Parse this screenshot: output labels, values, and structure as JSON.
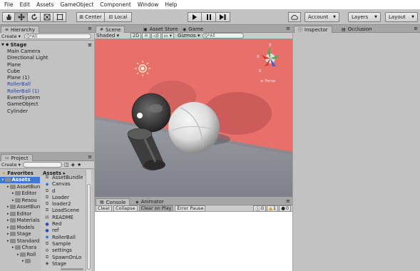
{
  "menu": [
    "File",
    "Edit",
    "Assets",
    "GameObject",
    "Component",
    "Window",
    "Help"
  ],
  "toolbar": {
    "tools": [
      "hand-icon",
      "move-icon",
      "rotate-icon",
      "scale-icon",
      "rect-icon"
    ],
    "center_label": "Center",
    "local_label": "Local",
    "play": "▶",
    "pause": "❚❚",
    "step": "▶❚",
    "account_label": "Account",
    "layers_label": "Layers",
    "layout_label": "Layout"
  },
  "hierarchy": {
    "tab": "Hierarchy",
    "create": "Create",
    "search_placeholder": "Q*All",
    "root": "Stage",
    "items": [
      {
        "label": "Main Camera",
        "prefab": false
      },
      {
        "label": "Directional Light",
        "prefab": false
      },
      {
        "label": "Plane",
        "prefab": false
      },
      {
        "label": "Cube",
        "prefab": false
      },
      {
        "label": "Plane (1)",
        "prefab": false
      },
      {
        "label": "RollerBall",
        "prefab": true
      },
      {
        "label": "RollerBall (1)",
        "prefab": true
      },
      {
        "label": "EventSystem",
        "prefab": false
      },
      {
        "label": "GameObject",
        "prefab": false
      },
      {
        "label": "Cylinder",
        "prefab": false
      }
    ]
  },
  "scene": {
    "tabs": [
      "Scene",
      "Asset Store",
      "Game"
    ],
    "shading": "Shaded",
    "mode_2d": "2D",
    "gizmos": "Gizmos",
    "search_placeholder": "Q*All",
    "persp_label": "≡ Persp",
    "axis_x": "x",
    "axis_y": "y",
    "axis_z": "z"
  },
  "inspector": {
    "tabs": [
      "Inspector",
      "Occlusion"
    ]
  },
  "console": {
    "tabs": [
      "Console",
      "Animator"
    ],
    "buttons": [
      "Clear",
      "Collapse",
      "Clear on Play",
      "Error Pause"
    ],
    "info_count": "0",
    "warn_count": "1",
    "error_count": "0"
  },
  "project": {
    "tab": "Project",
    "create": "Create",
    "favorites": "Favorites",
    "assets_header": "Assets",
    "breadcrumb": "Assets ▸",
    "tree": [
      {
        "label": "Assets",
        "level": 0
      },
      {
        "label": "AssetBun",
        "level": 1
      },
      {
        "label": "Editor",
        "level": 2
      },
      {
        "label": "Resou",
        "level": 2
      },
      {
        "label": "AssetBun",
        "level": 1
      },
      {
        "label": "Editor",
        "level": 1
      },
      {
        "label": "Materials",
        "level": 1
      },
      {
        "label": "Models",
        "level": 1
      },
      {
        "label": "Stage",
        "level": 1
      },
      {
        "label": "Standard",
        "level": 1
      },
      {
        "label": "Chara",
        "level": 2
      },
      {
        "label": "Roll",
        "level": 3
      },
      {
        "label": "",
        "level": 4
      }
    ],
    "assets": [
      {
        "label": "AssetBundle",
        "icon": "script-icon"
      },
      {
        "label": "Canvas",
        "icon": "prefab-icon"
      },
      {
        "label": "d",
        "icon": "script-icon"
      },
      {
        "label": "Loader",
        "icon": "script-icon"
      },
      {
        "label": "loader2",
        "icon": "script-icon"
      },
      {
        "label": "LoadScene",
        "icon": "script-icon"
      },
      {
        "label": "README",
        "icon": "text-icon"
      },
      {
        "label": "Red",
        "icon": "material-icon"
      },
      {
        "label": "ref",
        "icon": "material-icon"
      },
      {
        "label": "RollerBall",
        "icon": "prefab-icon"
      },
      {
        "label": "Sample",
        "icon": "script-icon"
      },
      {
        "label": "settings",
        "icon": "settings-icon"
      },
      {
        "label": "SpawnOnLo",
        "icon": "script-icon"
      },
      {
        "label": "Stage",
        "icon": "scene-icon"
      }
    ]
  },
  "colors": {
    "panel": "#c2c2c2",
    "scene_wall": "#e8706a",
    "scene_floor": "#8d8f97",
    "prefab_text": "#1f3fae"
  }
}
